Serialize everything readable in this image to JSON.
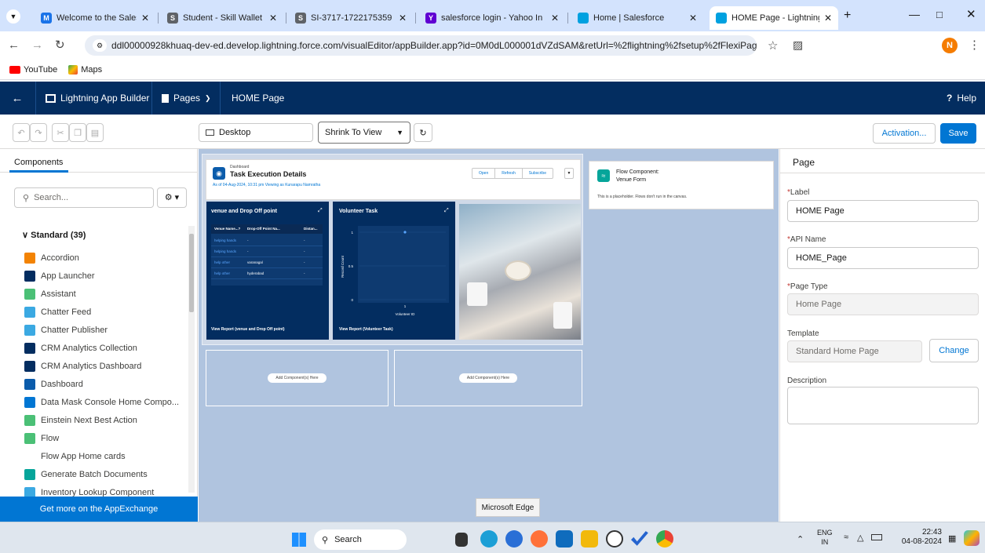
{
  "browser": {
    "tabs": [
      {
        "title": "Welcome to the Salesforce",
        "color": "#1a73e8",
        "fav": "M"
      },
      {
        "title": "Student - Skill Wallet",
        "color": "#5f6368",
        "fav": "S"
      },
      {
        "title": "SI-3717-1722175359",
        "color": "#5f6368",
        "fav": "S"
      },
      {
        "title": "salesforce login - Yahoo In",
        "color": "#6001d2",
        "fav": "Y"
      },
      {
        "title": "Home | Salesforce",
        "color": "#00a1e0",
        "fav": ""
      },
      {
        "title": "HOME Page - Lightning A",
        "color": "#00a1e0",
        "fav": ""
      }
    ],
    "url": "ddl00000928khuaq-dev-ed.develop.lightning.force.com/visualEditor/appBuilder.app?id=0M0dL000001dVZdSAM&retUrl=%2flightning%2fsetup%2fFlexiPageList%2fpage%3f%26address%3d%...",
    "profile_initial": "N",
    "bookmarks": [
      {
        "label": "YouTube"
      },
      {
        "label": "Maps"
      }
    ]
  },
  "header": {
    "app_name": "Lightning App Builder",
    "pages_label": "Pages",
    "page_name": "HOME Page",
    "help_label": "Help"
  },
  "toolbar": {
    "device": "Desktop",
    "zoom": "Shrink To View",
    "activation_label": "Activation...",
    "save_label": "Save"
  },
  "left": {
    "tab_label": "Components",
    "search_placeholder": "Search...",
    "section": "Standard (39)",
    "items": [
      {
        "label": "Accordion",
        "color": "#f38303"
      },
      {
        "label": "App Launcher",
        "color": "#032d60"
      },
      {
        "label": "Assistant",
        "color": "#4bc076"
      },
      {
        "label": "Chatter Feed",
        "color": "#3ba9e2"
      },
      {
        "label": "Chatter Publisher",
        "color": "#3ba9e2"
      },
      {
        "label": "CRM Analytics Collection",
        "color": "#032d60"
      },
      {
        "label": "CRM Analytics Dashboard",
        "color": "#032d60"
      },
      {
        "label": "Dashboard",
        "color": "#0b5cab"
      },
      {
        "label": "Data Mask Console Home Compo...",
        "color": "#0176d3"
      },
      {
        "label": "Einstein Next Best Action",
        "color": "#4bc076"
      },
      {
        "label": "Flow",
        "color": "#4bc076"
      },
      {
        "label": "Flow App Home cards",
        "color": ""
      },
      {
        "label": "Generate Batch Documents",
        "color": "#06a59a"
      },
      {
        "label": "Inventory Lookup Component",
        "color": "#3ba9e2"
      }
    ],
    "appexchange_label": "Get more on the AppExchange"
  },
  "canvas": {
    "dashboard": {
      "eyebrow": "Dashboard",
      "title": "Task Execution Details",
      "subtitle": "As of 04-Aug-2024, 10:31 pm Viewing as Kunarapu Namratha",
      "buttons": [
        "Open",
        "Refresh",
        "Subscribe"
      ],
      "table_widget": {
        "title": "venue and Drop Off point",
        "columns": [
          "Venue Name...?",
          "Drop-Off Point Na...",
          "Distan..."
        ],
        "rows": [
          [
            "helping hands",
            "-",
            "-"
          ],
          [
            "helping hands",
            "-",
            "-"
          ],
          [
            "help other",
            "varanagal",
            "-"
          ],
          [
            "help other",
            "hyderabad",
            "-"
          ]
        ],
        "footer": "View Report (venue and Drop Off point)"
      },
      "chart_widget": {
        "title": "Volunteer Task",
        "footer": "View Report (Volunteer Task)"
      }
    },
    "flow": {
      "title": "Flow Component:",
      "subtitle": "Venue Form",
      "note": "This is a placeholder. Flows don't run in the canvas."
    },
    "placeholder_label": "Add Component(s) Here"
  },
  "chart_data": {
    "type": "scatter",
    "title": "Volunteer Task",
    "xlabel": "Volunteer ID",
    "ylabel": "Record Count",
    "yticks": [
      "1",
      "0.5",
      "0"
    ],
    "xticks": [
      "1"
    ],
    "points": [
      {
        "x": 1,
        "y": 1
      }
    ],
    "ylim": [
      0,
      1
    ]
  },
  "right": {
    "title": "Page",
    "label_label": "Label",
    "label_value": "HOME Page",
    "api_label": "API Name",
    "api_value": "HOME_Page",
    "type_label": "Page Type",
    "type_value": "Home Page",
    "template_label": "Template",
    "template_value": "Standard Home Page",
    "change_label": "Change",
    "description_label": "Description"
  },
  "tooltip": "Microsoft Edge",
  "taskbar": {
    "search": "Search",
    "lang": "ENG",
    "region": "IN",
    "time": "22:43",
    "date": "04-08-2024"
  }
}
